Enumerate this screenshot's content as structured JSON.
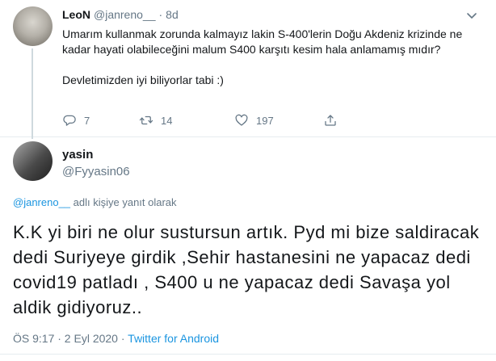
{
  "reply_tweet": {
    "author_name": "LeoN",
    "author_handle": "@janreno__",
    "separator": "·",
    "time": "8d",
    "text_paragraphs": [
      "Umarım kullanmak zorunda kalmayız lakin S-400'lerin Doğu Akdeniz krizinde ne kadar hayati olabileceğini malum S400 karşıtı kesim hala anlamamış mıdır?",
      "Devletimizden iyi biliyorlar tabi :)"
    ],
    "reply_count": "7",
    "retweet_count": "14",
    "like_count": "197"
  },
  "main_tweet": {
    "author_name": "yasin",
    "author_handle": "@Fyyasin06",
    "replying_mention": "@janreno__",
    "replying_text": " adlı kişiye yanıt olarak",
    "text": "K.K yi biri ne olur sustursun artık. Pyd mi bize saldiracak dedi Suriyeye girdik ,Sehir hastanesini ne yapacaz dedi covid19 patladı , S400 u ne yapacaz dedi Savaşa yol aldik gidiyoruz..",
    "timestamp": "ÖS 9:17 · 2 Eyl 2020",
    "separator": " · ",
    "source": "Twitter for Android"
  },
  "colors": {
    "text": "#14171a",
    "secondary": "#657786",
    "link": "#1b95e0",
    "divider": "#e6ecf0"
  },
  "icons": {
    "reply": "reply-icon",
    "retweet": "retweet-icon",
    "like": "heart-icon",
    "more": "chevron-down-icon"
  }
}
